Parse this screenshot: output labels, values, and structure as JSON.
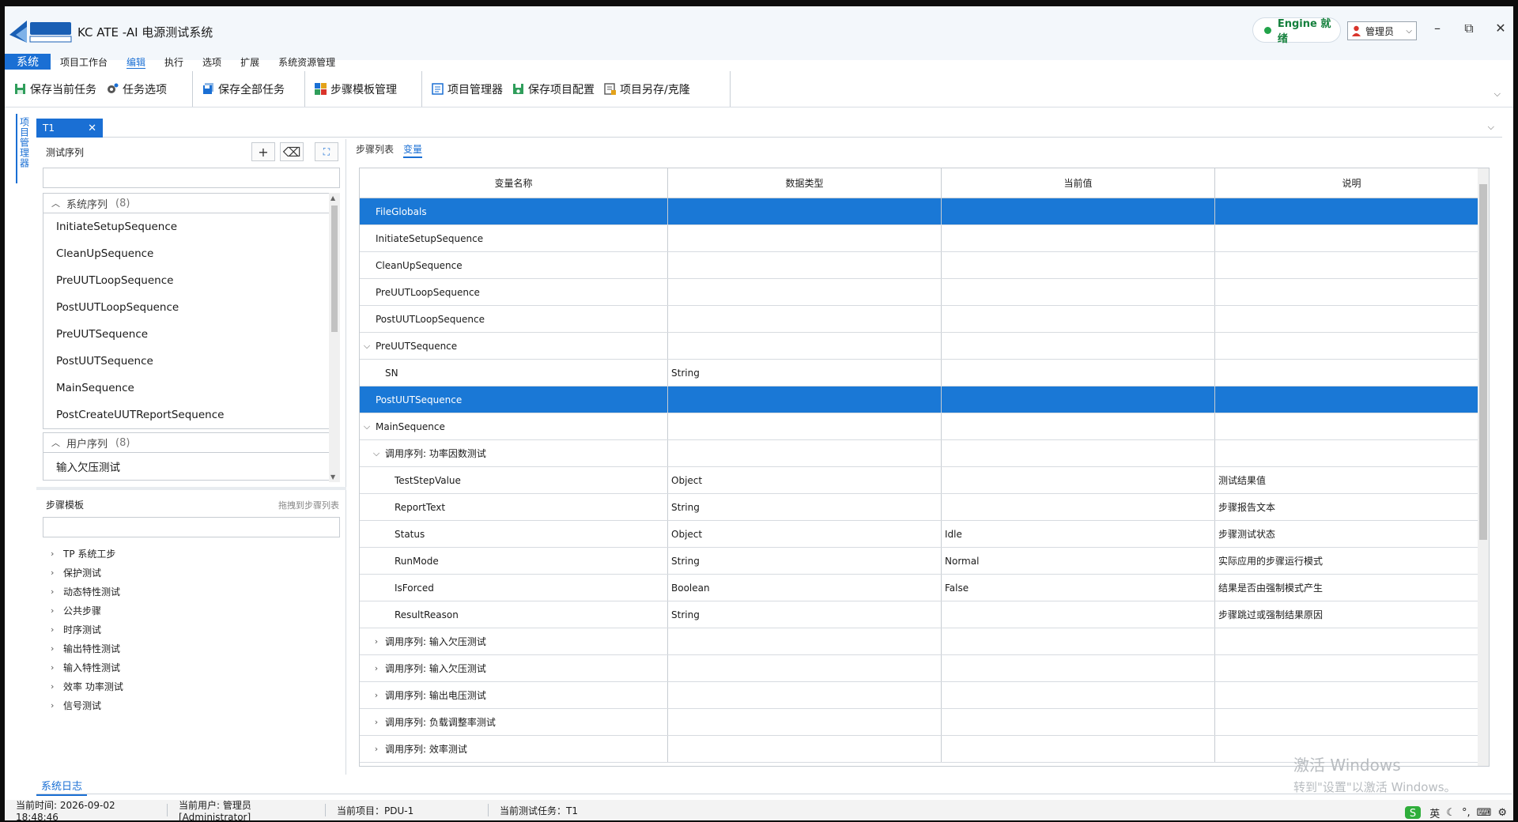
{
  "app": {
    "title": "KC ATE -AI 电源测试系统",
    "engine_status": "Engine 就绪",
    "user": "管理员"
  },
  "menu": [
    "系统",
    "项目工作台",
    "编辑",
    "执行",
    "选项",
    "扩展",
    "系统资源管理"
  ],
  "toolbar": {
    "save_current": "保存当前任务",
    "task_options": "任务选项",
    "save_all": "保存全部任务",
    "step_template_mgmt": "步骤模板管理",
    "project_manager": "项目管理器",
    "save_project_config": "保存项目配置",
    "project_save_as": "项目另存/克隆"
  },
  "vertical_tab": "项目管理器",
  "doc_tab": "T1",
  "left": {
    "seq_header": "测试序列",
    "system_group": {
      "label": "系统序列",
      "count": "(8)"
    },
    "system_items": [
      "InitiateSetupSequence",
      "CleanUpSequence",
      "PreUUTLoopSequence",
      "PostUUTLoopSequence",
      "PreUUTSequence",
      "PostUUTSequence",
      "MainSequence",
      "PostCreateUUTReportSequence"
    ],
    "user_group": {
      "label": "用户序列",
      "count": "(8)"
    },
    "user_items": [
      "输入欠压测试"
    ],
    "template_header": "步骤模板",
    "template_hint": "拖拽到步骤列表",
    "templates": [
      "TP 系统工步",
      "保护测试",
      "动态特性测试",
      "公共步骤",
      "时序测试",
      "输出特性测试",
      "输入特性测试",
      "效率 功率测试",
      "信号测试"
    ]
  },
  "right": {
    "tabs": [
      "步骤列表",
      "变量"
    ],
    "columns": [
      "变量名称",
      "数据类型",
      "当前值",
      "说明"
    ],
    "rows": [
      {
        "indent": 0,
        "expander": "",
        "name": "FileGlobals",
        "type": "",
        "value": "",
        "desc": "",
        "selected": true
      },
      {
        "indent": 0,
        "expander": "",
        "name": "InitiateSetupSequence",
        "type": "",
        "value": "",
        "desc": "",
        "selected": false
      },
      {
        "indent": 0,
        "expander": "",
        "name": "CleanUpSequence",
        "type": "",
        "value": "",
        "desc": "",
        "selected": false
      },
      {
        "indent": 0,
        "expander": "",
        "name": "PreUUTLoopSequence",
        "type": "",
        "value": "",
        "desc": "",
        "selected": false
      },
      {
        "indent": 0,
        "expander": "",
        "name": "PostUUTLoopSequence",
        "type": "",
        "value": "",
        "desc": "",
        "selected": false
      },
      {
        "indent": 0,
        "expander": "open",
        "name": "PreUUTSequence",
        "type": "",
        "value": "",
        "desc": "",
        "selected": false
      },
      {
        "indent": 1,
        "expander": "",
        "name": "SN",
        "type": "String",
        "value": "",
        "desc": "",
        "selected": false
      },
      {
        "indent": 0,
        "expander": "",
        "name": "PostUUTSequence",
        "type": "",
        "value": "",
        "desc": "",
        "selected": true
      },
      {
        "indent": 0,
        "expander": "open",
        "name": "MainSequence",
        "type": "",
        "value": "",
        "desc": "",
        "selected": false
      },
      {
        "indent": 1,
        "expander": "open",
        "name": "调用序列: 功率因数测试",
        "type": "",
        "value": "",
        "desc": "",
        "selected": false
      },
      {
        "indent": 2,
        "expander": "",
        "name": "TestStepValue",
        "type": "Object",
        "value": "",
        "desc": "测试结果值",
        "selected": false
      },
      {
        "indent": 2,
        "expander": "",
        "name": "ReportText",
        "type": "String",
        "value": "",
        "desc": "步骤报告文本",
        "selected": false
      },
      {
        "indent": 2,
        "expander": "",
        "name": "Status",
        "type": "Object",
        "value": "Idle",
        "desc": "步骤测试状态",
        "selected": false
      },
      {
        "indent": 2,
        "expander": "",
        "name": "RunMode",
        "type": "String",
        "value": "Normal",
        "desc": "实际应用的步骤运行模式",
        "selected": false
      },
      {
        "indent": 2,
        "expander": "",
        "name": "IsForced",
        "type": "Boolean",
        "value": "False",
        "desc": "结果是否由强制模式产生",
        "selected": false
      },
      {
        "indent": 2,
        "expander": "",
        "name": "ResultReason",
        "type": "String",
        "value": "",
        "desc": "步骤跳过或强制结果原因",
        "selected": false
      },
      {
        "indent": 1,
        "expander": "closed",
        "name": "调用序列: 输入欠压测试",
        "type": "",
        "value": "",
        "desc": "",
        "selected": false
      },
      {
        "indent": 1,
        "expander": "closed",
        "name": "调用序列: 输入欠压测试",
        "type": "",
        "value": "",
        "desc": "",
        "selected": false
      },
      {
        "indent": 1,
        "expander": "closed",
        "name": "调用序列: 输出电压测试",
        "type": "",
        "value": "",
        "desc": "",
        "selected": false
      },
      {
        "indent": 1,
        "expander": "closed",
        "name": "调用序列: 负载调整率测试",
        "type": "",
        "value": "",
        "desc": "",
        "selected": false
      },
      {
        "indent": 1,
        "expander": "closed",
        "name": "调用序列: 效率测试",
        "type": "",
        "value": "",
        "desc": "",
        "selected": false
      }
    ]
  },
  "syslog_tab": "系统日志",
  "status": {
    "time": "当前时间: 2026-09-02 18:48:46",
    "user": "当前用户: 管理员 [Administrator]",
    "project": "当前项目：PDU-1",
    "task": "当前测试任务：T1"
  },
  "tray": {
    "ime": "英"
  },
  "watermark": {
    "line1": "激活 Windows",
    "line2": "转到\"设置\"以激活 Windows。"
  },
  "colors": {
    "accent": "#1a6fd4",
    "selected_row": "#1a78d6",
    "engine_ok": "#22a34a"
  }
}
